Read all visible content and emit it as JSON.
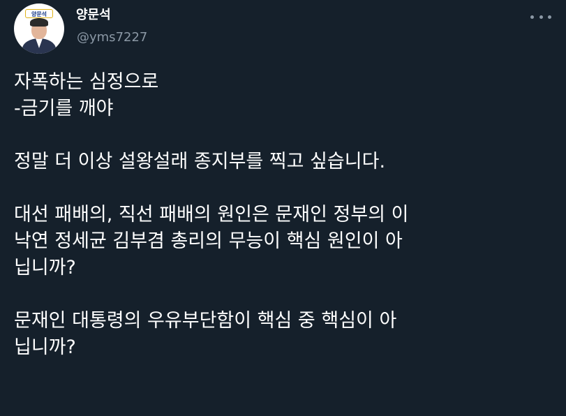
{
  "author": {
    "display_name": "양문석",
    "handle": "@yms7227",
    "avatar_badge": "양문석"
  },
  "more_icon": "more-horizontal-icon",
  "colors": {
    "background": "#15202b",
    "text": "#ffffff",
    "secondary_text": "#8b98a5"
  },
  "tweet": {
    "line1": "자폭하는 심정으로",
    "line2": "-금기를 깨야",
    "line3": "정말 더 이상 설왕설래 종지부를 찍고 싶습니다.",
    "line4": "대선 패배의, 직선 패배의 원인은 문재인 정부의 이",
    "line5": "낙연 정세균 김부겸 총리의 무능이 핵심 원인이 아",
    "line6": "닙니까?",
    "line7": "문재인 대통령의 우유부단함이 핵심 중 핵심이 아",
    "line8": "닙니까?"
  }
}
